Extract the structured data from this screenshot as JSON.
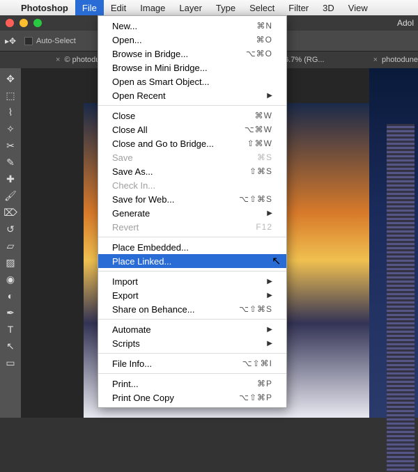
{
  "menubar": {
    "apple": "",
    "app": "Photoshop",
    "items": [
      "File",
      "Edit",
      "Image",
      "Layer",
      "Type",
      "Select",
      "Filter",
      "3D",
      "View"
    ],
    "active": "File"
  },
  "appTitleRight": "Adol",
  "options": {
    "autoSelect": "Auto-Select"
  },
  "tabs": {
    "left": "© photodu...",
    "right_prefix": "@ 16.7% (RG...",
    "far": "photodune"
  },
  "fileMenu": {
    "items": [
      {
        "label": "New...",
        "shortcut": "⌘N"
      },
      {
        "label": "Open...",
        "shortcut": "⌘O"
      },
      {
        "label": "Browse in Bridge...",
        "shortcut": "⌥⌘O"
      },
      {
        "label": "Browse in Mini Bridge..."
      },
      {
        "label": "Open as Smart Object..."
      },
      {
        "label": "Open Recent",
        "submenu": true
      },
      {
        "sep": true
      },
      {
        "label": "Close",
        "shortcut": "⌘W"
      },
      {
        "label": "Close All",
        "shortcut": "⌥⌘W"
      },
      {
        "label": "Close and Go to Bridge...",
        "shortcut": "⇧⌘W"
      },
      {
        "label": "Save",
        "shortcut": "⌘S",
        "disabled": true
      },
      {
        "label": "Save As...",
        "shortcut": "⇧⌘S"
      },
      {
        "label": "Check In...",
        "disabled": true
      },
      {
        "label": "Save for Web...",
        "shortcut": "⌥⇧⌘S"
      },
      {
        "label": "Generate",
        "submenu": true
      },
      {
        "label": "Revert",
        "shortcut": "F12",
        "disabled": true
      },
      {
        "sep": true
      },
      {
        "label": "Place Embedded..."
      },
      {
        "label": "Place Linked...",
        "highlighted": true
      },
      {
        "sep": true
      },
      {
        "label": "Import",
        "submenu": true
      },
      {
        "label": "Export",
        "submenu": true
      },
      {
        "label": "Share on Behance...",
        "shortcut": "⌥⇧⌘S"
      },
      {
        "sep": true
      },
      {
        "label": "Automate",
        "submenu": true
      },
      {
        "label": "Scripts",
        "submenu": true
      },
      {
        "sep": true
      },
      {
        "label": "File Info...",
        "shortcut": "⌥⇧⌘I"
      },
      {
        "sep": true
      },
      {
        "label": "Print...",
        "shortcut": "⌘P"
      },
      {
        "label": "Print One Copy",
        "shortcut": "⌥⇧⌘P"
      }
    ]
  },
  "tools": [
    "move",
    "marquee",
    "lasso",
    "wand",
    "crop",
    "eyedropper",
    "heal",
    "brush",
    "stamp",
    "history",
    "eraser",
    "gradient",
    "blur",
    "dodge",
    "pen",
    "type",
    "path",
    "shape"
  ]
}
